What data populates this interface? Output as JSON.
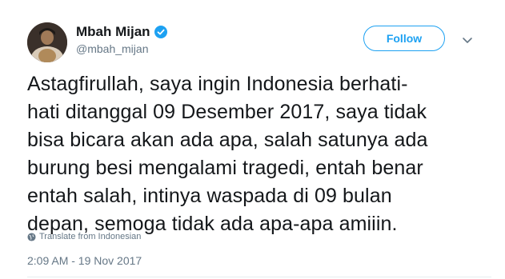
{
  "tweet": {
    "author": {
      "display_name": "Mbah Mijan",
      "handle": "@mbah_mijan",
      "verified": true
    },
    "follow_label": "Follow",
    "text_lines": [
      "Astagfirullah, saya ingin Indonesia berhati-",
      "hati ditanggal 09 Desember 2017, saya tidak",
      "bisa bicara akan ada apa, salah satunya ada",
      "burung besi mengalami tragedi, entah benar",
      "entah salah, intinya waspada di 09 bulan",
      "depan, semoga tidak ada apa-apa amiiin."
    ],
    "translate_label": "Translate from Indonesian",
    "timestamp": "2:09 AM - 19 Nov 2017"
  },
  "icons": {
    "verified": "verified-badge-icon",
    "caret": "chevron-down-icon",
    "translate": "globe-icon"
  },
  "colors": {
    "accent": "#1da1f2",
    "text": "#14171a",
    "muted": "#657786",
    "divider": "#e6ecf0"
  }
}
